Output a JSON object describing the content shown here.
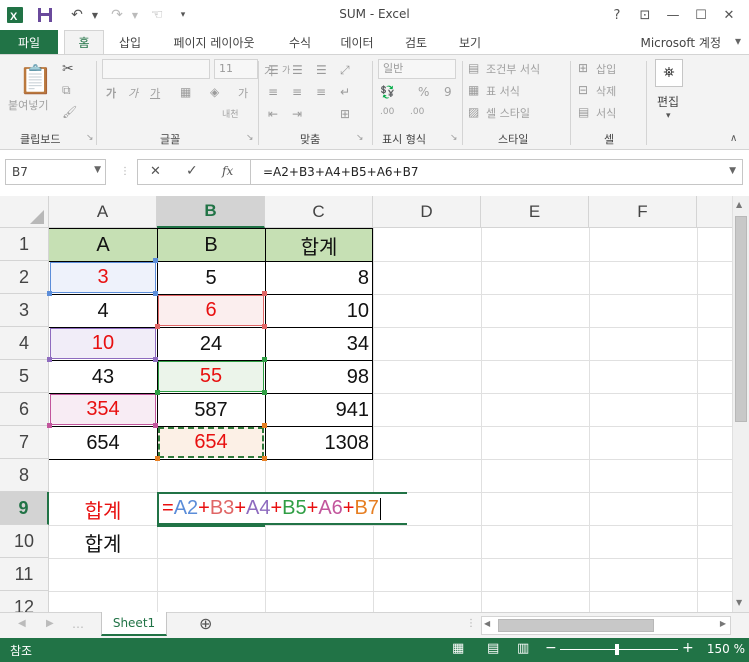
{
  "title_bar": {
    "title": "SUM - Excel",
    "help": "?",
    "restore_ribbon": "⊡",
    "minimize": "—",
    "maximize": "☐",
    "close": "✕"
  },
  "tabs": {
    "file": "파일",
    "items": [
      "홈",
      "삽입",
      "페이지 레이아웃",
      "수식",
      "데이터",
      "검토",
      "보기"
    ],
    "active": "홈",
    "account": "Microsoft 계정"
  },
  "ribbon": {
    "groups": {
      "clipboard": "클립보드",
      "font": "글꼴",
      "alignment": "맞춤",
      "number": "표시 형식",
      "styles": "스타일",
      "cells": "셀",
      "editing": "편집"
    },
    "paste": "붙여넣기",
    "font_size": "11",
    "number_format": "일반",
    "bold": "가",
    "italic": "가",
    "underline": "가",
    "grow": "가",
    "shrink": "가",
    "ga_label": "내천",
    "percent": "%",
    "comma": "9",
    "dec_inc": ".00",
    "dec_dec": ".00",
    "cond_format": "조건부 서식",
    "table_format": "표 서식",
    "cell_style": "셀 스타일",
    "insert": "삽입",
    "delete": "삭제",
    "format": "서식",
    "editing": "편집"
  },
  "formula_bar": {
    "name_box": "B7",
    "cancel": "✕",
    "enter": "✓",
    "fx": "fx",
    "formula": "=A2+B3+A4+B5+A6+B7"
  },
  "grid": {
    "columns": [
      "A",
      "B",
      "C",
      "D",
      "E",
      "F"
    ],
    "rows": [
      "1",
      "2",
      "3",
      "4",
      "5",
      "6",
      "7",
      "8",
      "9",
      "10",
      "11",
      "12"
    ],
    "header_row": [
      "A",
      "B",
      "합계"
    ],
    "data": [
      [
        "3",
        "5",
        "8"
      ],
      [
        "4",
        "6",
        "10"
      ],
      [
        "10",
        "24",
        "34"
      ],
      [
        "43",
        "55",
        "98"
      ],
      [
        "354",
        "587",
        "941"
      ],
      [
        "654",
        "654",
        "1308"
      ]
    ],
    "a9": "합계",
    "a10": "합계",
    "edit_formula": {
      "eq": "=",
      "parts": [
        {
          "ref": "A2",
          "color": "#5b8dd9"
        },
        {
          "op": "+",
          "ref": "B3",
          "color": "#e06666"
        },
        {
          "op": "+",
          "ref": "A4",
          "color": "#8e6bbf"
        },
        {
          "op": "+",
          "ref": "B5",
          "color": "#2f9e44"
        },
        {
          "op": "+",
          "ref": "A6",
          "color": "#c2559c"
        },
        {
          "op": "+",
          "ref": "B7",
          "color": "#e67e22"
        }
      ]
    }
  },
  "sheets": {
    "tabs": [
      "Sheet1"
    ],
    "add": "⊕"
  },
  "status": {
    "mode": "참조",
    "zoom": "150 %"
  },
  "colors": {
    "accent": "#217346",
    "header_fill": "#c6e0b4",
    "red_text": "#e81010"
  }
}
